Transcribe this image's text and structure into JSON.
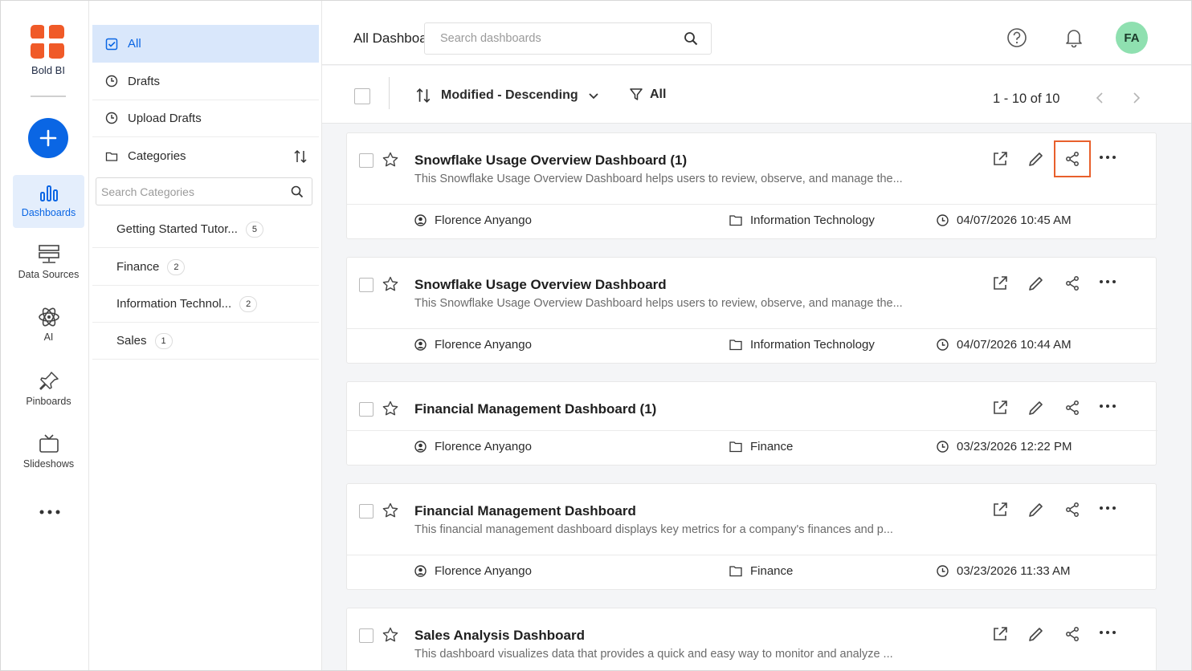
{
  "brand": {
    "name": "Bold BI"
  },
  "rail": {
    "items": [
      {
        "label": "Dashboards",
        "icon": "bar-chart-icon",
        "active": true
      },
      {
        "label": "Data Sources",
        "icon": "server-icon"
      },
      {
        "label": "AI",
        "icon": "atom-icon"
      },
      {
        "label": "Pinboards",
        "icon": "pin-icon"
      },
      {
        "label": "Slideshows",
        "icon": "tv-icon"
      }
    ]
  },
  "categories": {
    "nav": [
      {
        "label": "All"
      },
      {
        "label": "Drafts"
      },
      {
        "label": "Upload Drafts"
      },
      {
        "label": "Categories"
      }
    ],
    "search_placeholder": "Search Categories",
    "items": [
      {
        "label": "Getting Started Tutor...",
        "count": "5"
      },
      {
        "label": "Finance",
        "count": "2"
      },
      {
        "label": "Information Technol...",
        "count": "2"
      },
      {
        "label": "Sales",
        "count": "1"
      }
    ]
  },
  "header": {
    "title": "All Dashboards",
    "search_placeholder": "Search dashboards",
    "avatar": "FA"
  },
  "toolbar": {
    "sort_label": "Modified - Descending",
    "filter_label": "All",
    "pager": "1 - 10 of 10"
  },
  "dashboards": [
    {
      "title": "Snowflake Usage Overview Dashboard (1)",
      "desc": "This Snowflake Usage Overview Dashboard helps users to review, observe, and manage the...",
      "owner": "Florence Anyango",
      "category": "Information Technology",
      "modified": "04/07/2026 10:45 AM"
    },
    {
      "title": "Snowflake Usage Overview Dashboard",
      "desc": "This Snowflake Usage Overview Dashboard helps users to review, observe, and manage the...",
      "owner": "Florence Anyango",
      "category": "Information Technology",
      "modified": "04/07/2026 10:44 AM"
    },
    {
      "title": "Financial Management Dashboard (1)",
      "desc": "",
      "owner": "Florence Anyango",
      "category": "Finance",
      "modified": "03/23/2026 12:22 PM"
    },
    {
      "title": "Financial Management Dashboard",
      "desc": "This financial management dashboard displays key metrics for a company's finances and p...",
      "owner": "Florence Anyango",
      "category": "Finance",
      "modified": "03/23/2026 11:33 AM"
    },
    {
      "title": "Sales Analysis Dashboard",
      "desc": "This dashboard visualizes data that provides a quick and easy way to monitor and analyze ...",
      "owner": "",
      "category": "",
      "modified": ""
    }
  ],
  "colors": {
    "accent": "#0a66e4",
    "highlight": "#e8602c",
    "brand": "#f05a28"
  }
}
